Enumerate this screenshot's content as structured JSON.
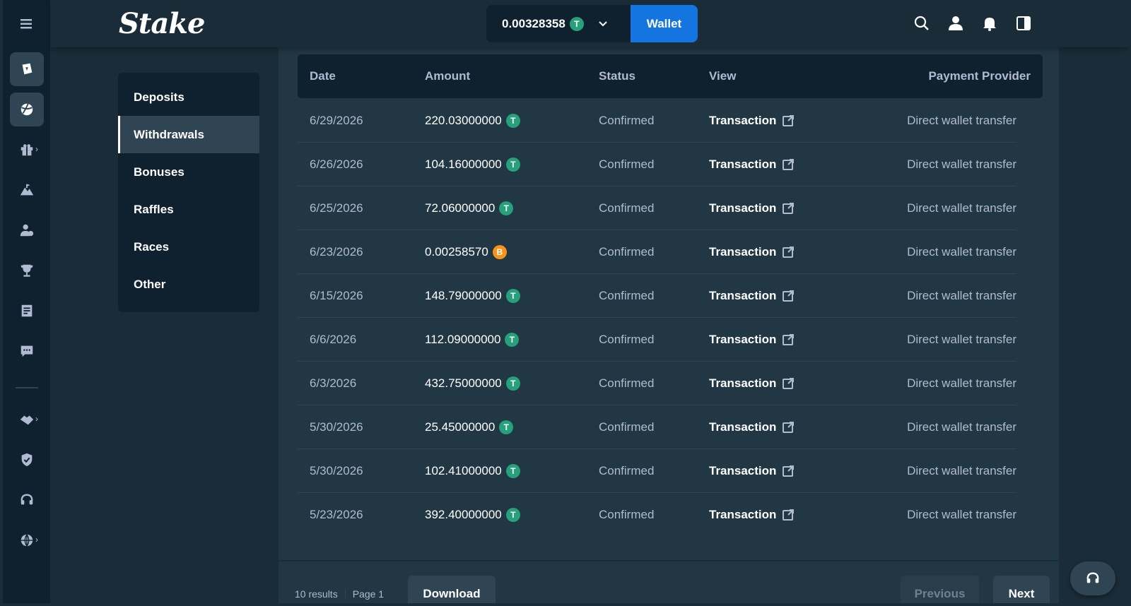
{
  "header": {
    "logo": "Stake",
    "balance": "0.00328358",
    "wallet_label": "Wallet",
    "coin_symbol": "T"
  },
  "submenu": {
    "items": [
      "Deposits",
      "Withdrawals",
      "Bonuses",
      "Raffles",
      "Races",
      "Other"
    ],
    "active": "Withdrawals"
  },
  "table": {
    "headers": {
      "date": "Date",
      "amount": "Amount",
      "status": "Status",
      "view": "View",
      "provider": "Payment Provider"
    },
    "rows": [
      {
        "date": "6/29/2026",
        "amount": "220.03000000",
        "coin": "T",
        "status": "Confirmed",
        "view": "Transaction",
        "provider": "Direct wallet transfer"
      },
      {
        "date": "6/26/2026",
        "amount": "104.16000000",
        "coin": "T",
        "status": "Confirmed",
        "view": "Transaction",
        "provider": "Direct wallet transfer"
      },
      {
        "date": "6/25/2026",
        "amount": "72.06000000",
        "coin": "T",
        "status": "Confirmed",
        "view": "Transaction",
        "provider": "Direct wallet transfer"
      },
      {
        "date": "6/23/2026",
        "amount": "0.00258570",
        "coin": "B",
        "status": "Confirmed",
        "view": "Transaction",
        "provider": "Direct wallet transfer"
      },
      {
        "date": "6/15/2026",
        "amount": "148.79000000",
        "coin": "T",
        "status": "Confirmed",
        "view": "Transaction",
        "provider": "Direct wallet transfer"
      },
      {
        "date": "6/6/2026",
        "amount": "112.09000000",
        "coin": "T",
        "status": "Confirmed",
        "view": "Transaction",
        "provider": "Direct wallet transfer"
      },
      {
        "date": "6/3/2026",
        "amount": "432.75000000",
        "coin": "T",
        "status": "Confirmed",
        "view": "Transaction",
        "provider": "Direct wallet transfer"
      },
      {
        "date": "5/30/2026",
        "amount": "25.45000000",
        "coin": "T",
        "status": "Confirmed",
        "view": "Transaction",
        "provider": "Direct wallet transfer"
      },
      {
        "date": "5/30/2026",
        "amount": "102.41000000",
        "coin": "T",
        "status": "Confirmed",
        "view": "Transaction",
        "provider": "Direct wallet transfer"
      },
      {
        "date": "5/23/2026",
        "amount": "392.40000000",
        "coin": "T",
        "status": "Confirmed",
        "view": "Transaction",
        "provider": "Direct wallet transfer"
      }
    ]
  },
  "footer": {
    "results": "10 results",
    "page": "Page 1",
    "download_label": "Download",
    "previous_label": "Previous",
    "next_label": "Next"
  },
  "colors": {
    "background": "#1a2c38",
    "panel": "#213743",
    "dark": "#0f212e",
    "accent_blue": "#1475e1",
    "usdt_green": "#26a17b",
    "btc_orange": "#f7931a",
    "muted_text": "#b1bad3"
  },
  "icons": [
    "menu-icon",
    "casino-icon",
    "sports-icon",
    "gift-icon",
    "mountain-icon",
    "affiliate-icon",
    "trophy-icon",
    "blog-icon",
    "chat-icon",
    "handshake-icon",
    "shield-icon",
    "headset-icon",
    "globe-icon",
    "search-icon",
    "user-icon",
    "bell-icon",
    "sidebar-toggle-icon",
    "external-link-icon"
  ]
}
